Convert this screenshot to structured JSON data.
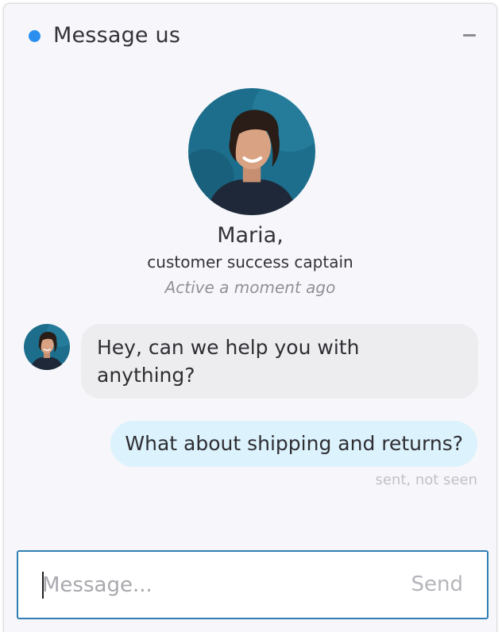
{
  "header": {
    "title": "Message us",
    "status_color": "#2b8ff0",
    "minimize_icon": "minus-icon"
  },
  "agent": {
    "name": "Maria,",
    "role": "customer success captain",
    "status": "Active a moment ago"
  },
  "messages": [
    {
      "from": "agent",
      "text": "Hey, can we help you with anything?"
    },
    {
      "from": "user",
      "text": "What about shipping and returns?",
      "status": "sent, not seen"
    }
  ],
  "composer": {
    "placeholder": "Message...",
    "value": "",
    "send_label": "Send"
  },
  "colors": {
    "accent": "#2b8ff0",
    "user_bubble": "#dcf2fc",
    "agent_bubble": "#ededf0",
    "input_border": "#2f7fb5"
  }
}
